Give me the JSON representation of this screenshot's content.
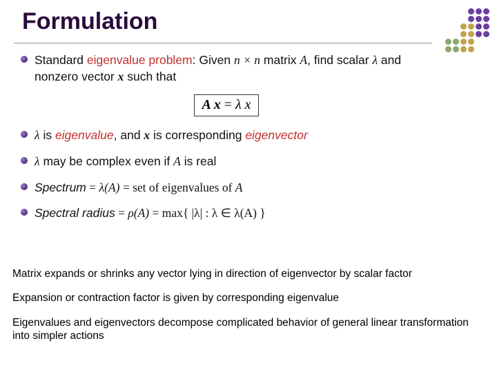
{
  "title": "Formulation",
  "bullets": {
    "b1_pre": "Standard ",
    "b1_red": "eigenvalue problem",
    "b1_mid": ": Given ",
    "b1_nxn": "n × n",
    "b1_matrix": " matrix ",
    "b1_A": "A",
    "b1_post": ", find scalar ",
    "b1_lambda": "λ",
    "b1_and": " and nonzero vector ",
    "b1_x": "x",
    "b1_such": " such that",
    "eq_lhs": "A x",
    "eq_eq": " = ",
    "eq_rhs": "λ x",
    "b2_lambda": "λ",
    "b2_is": " is ",
    "b2_red1": "eigenvalue",
    "b2_and": ", and ",
    "b2_x": "x",
    "b2_corr": " is corresponding ",
    "b2_red2": "eigenvector",
    "b3_lambda": "λ",
    "b3_txt": " may be complex even if ",
    "b3_A": "A",
    "b3_end": " is real",
    "b4_spec": "Spectrum",
    "b4_eq": " = ",
    "b4_lamA": "λ(A)",
    "b4_set": " = set of eigenvalues of ",
    "b4_A": "A",
    "b5_spec": "Spectral radius",
    "b5_eq": " = ",
    "b5_rhoA": "ρ(A)",
    "b5_max": " = max{ |λ|  :  λ ∈ λ(A) }"
  },
  "bottom": {
    "p1": "Matrix expands or shrinks any vector lying in direction of eigenvector by scalar factor",
    "p2": "Expansion or contraction factor is given by corresponding eigenvalue",
    "p3": "Eigenvalues and eigenvectors decompose complicated behavior of general linear transformation into simpler actions"
  }
}
